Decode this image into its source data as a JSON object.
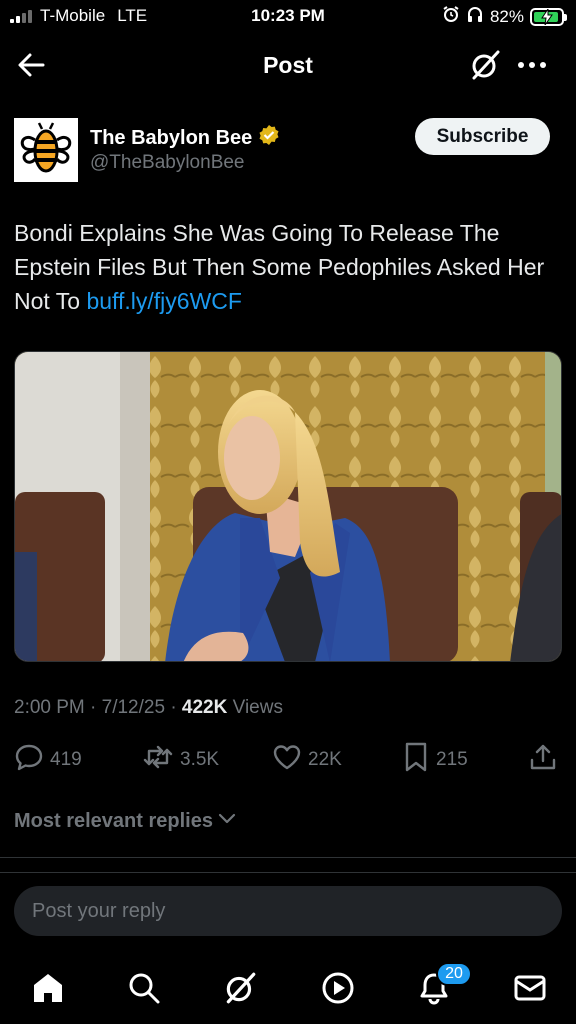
{
  "status_bar": {
    "carrier": "T-Mobile",
    "network": "LTE",
    "time": "10:23 PM",
    "battery": "82%"
  },
  "header": {
    "title": "Post"
  },
  "author": {
    "name": "The Babylon Bee",
    "handle": "@TheBabylonBee",
    "subscribe_label": "Subscribe"
  },
  "tweet": {
    "text": "Bondi Explains She Was Going To Release The Epstein Files But Then Some Pedophiles Asked Her Not To",
    "link": "buff.ly/fjy6WCF"
  },
  "meta": {
    "timestamp": "2:00 PM · 7/12/25 · ",
    "views_count": "422K",
    "views_label": " Views"
  },
  "actions": {
    "replies": "419",
    "reposts": "3.5K",
    "likes": "22K",
    "bookmarks": "215"
  },
  "replies_filter": {
    "label": "Most relevant replies"
  },
  "reply_box": {
    "placeholder": "Post your reply"
  },
  "nav": {
    "notification_count": "20"
  },
  "colors": {
    "accent": "#1d9bf0",
    "background": "#000000",
    "secondary_text": "#71767b",
    "verified": "#e2b719"
  }
}
